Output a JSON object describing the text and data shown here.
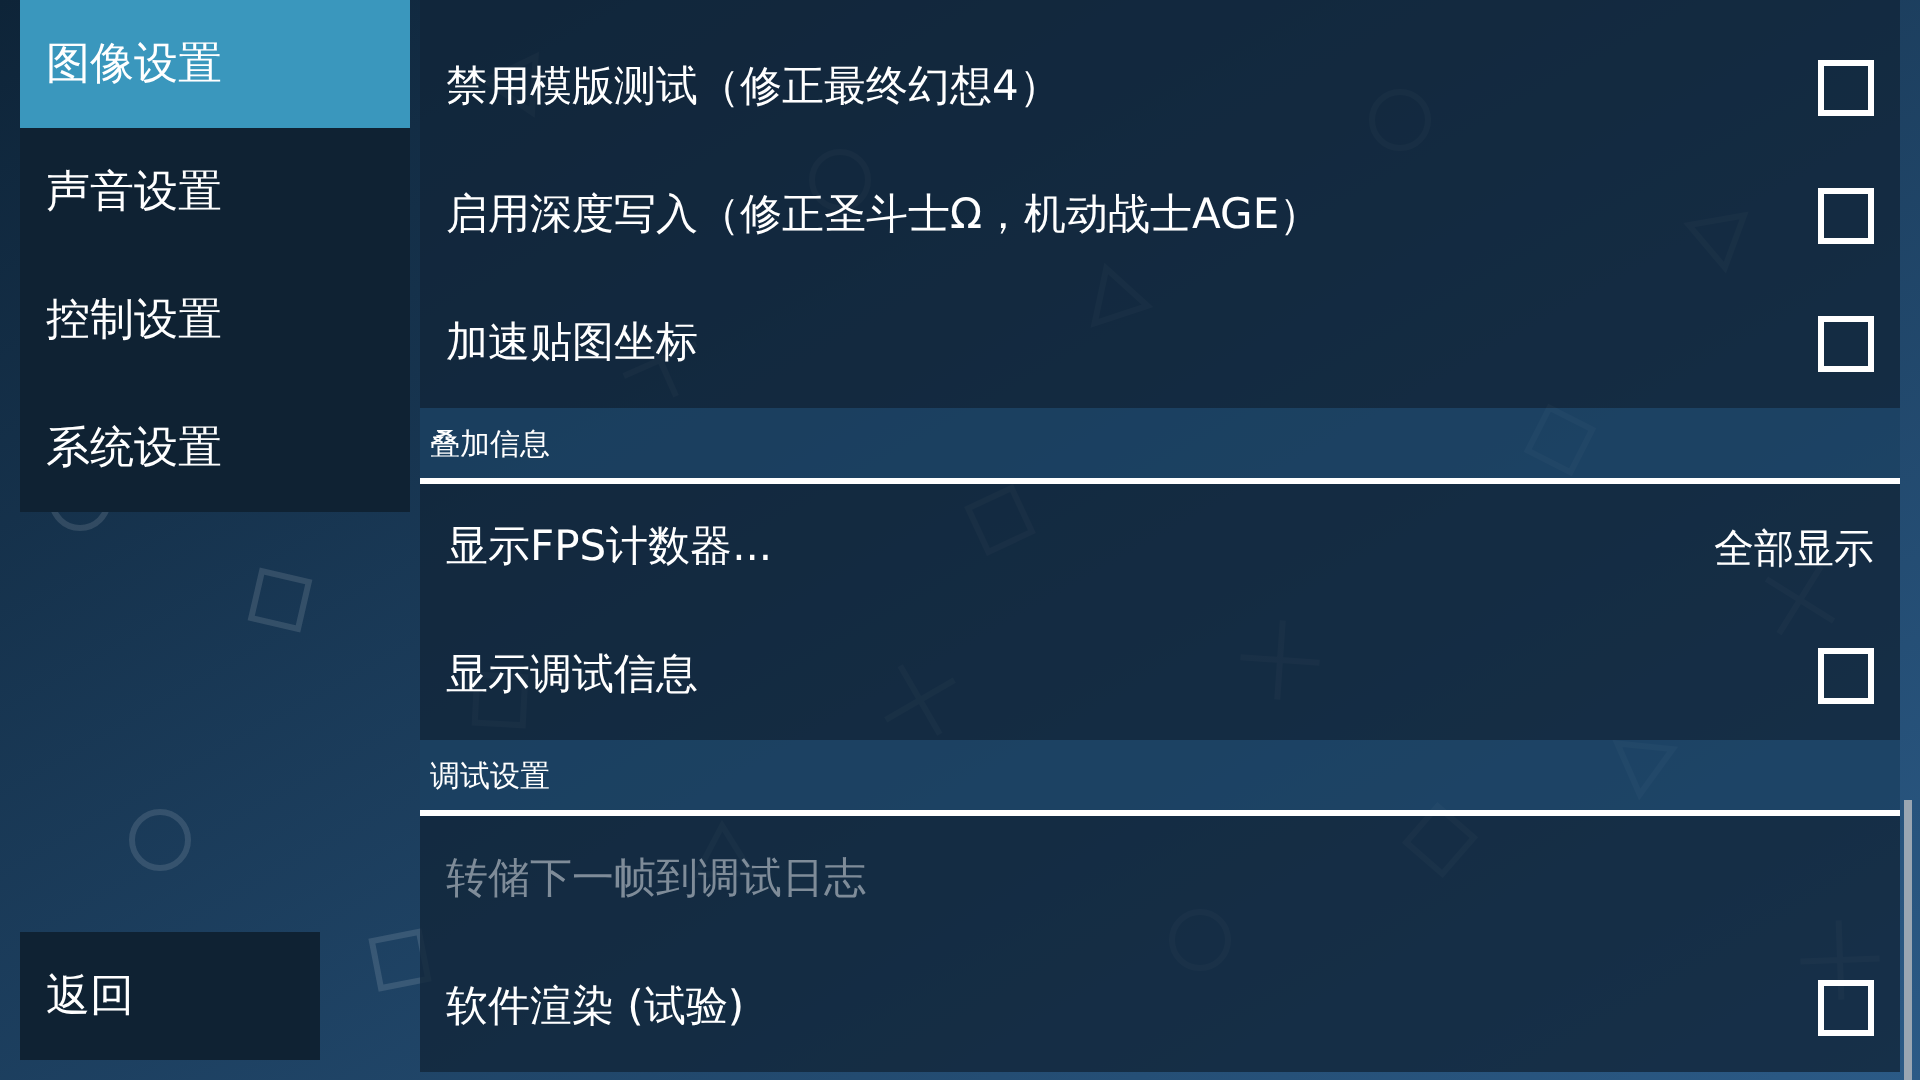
{
  "sidebar": {
    "tabs": [
      {
        "label": "图像设置",
        "selected": true
      },
      {
        "label": "声音设置",
        "selected": false
      },
      {
        "label": "控制设置",
        "selected": false
      },
      {
        "label": "系统设置",
        "selected": false
      }
    ],
    "back_button": "返回"
  },
  "sections": [
    {
      "items": [
        {
          "kind": "checkbox",
          "label": "禁用模版测试（修正最终幻想4）",
          "checked": false,
          "disabled": false
        },
        {
          "kind": "checkbox",
          "label": "启用深度写入（修正圣斗士Ω，机动战士AGE）",
          "checked": false,
          "disabled": false
        },
        {
          "kind": "checkbox",
          "label": "加速贴图坐标",
          "checked": false,
          "disabled": false
        }
      ]
    },
    {
      "header": "叠加信息",
      "items": [
        {
          "kind": "choice",
          "label": "显示FPS计数器...",
          "value": "全部显示",
          "disabled": false
        },
        {
          "kind": "checkbox",
          "label": "显示调试信息",
          "checked": false,
          "disabled": false
        }
      ]
    },
    {
      "header": "调试设置",
      "items": [
        {
          "kind": "action",
          "label": "转储下一帧到调试日志",
          "disabled": true
        },
        {
          "kind": "checkbox",
          "label": "软件渲染 (试验)",
          "checked": false,
          "disabled": false
        }
      ]
    }
  ]
}
